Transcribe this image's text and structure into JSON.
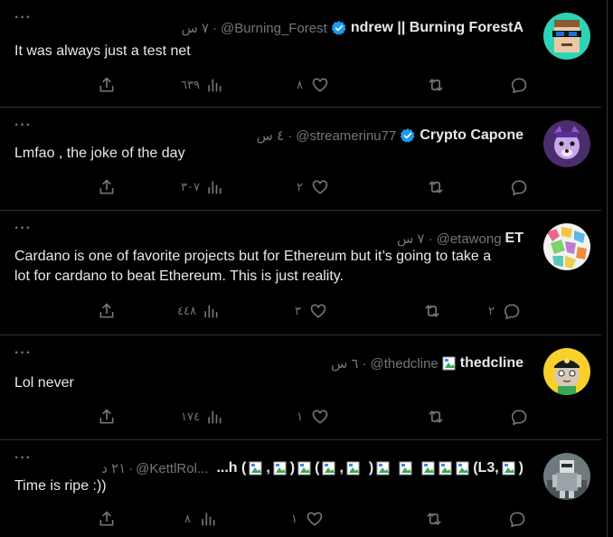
{
  "tweets": [
    {
      "name": "ndrew || Burning ForestA",
      "handle": "@Burning_Forest",
      "time": "٧ س",
      "text": "It was always just a test net",
      "views": "٦٣٩",
      "likes": "٨",
      "retweets": "",
      "replies": "",
      "verified": true
    },
    {
      "name": "Crypto Capone",
      "handle": "@streamerinu77",
      "time": "٤ س",
      "text": "Lmfao , the joke of the day",
      "views": "٣٠٧",
      "likes": "٢",
      "retweets": "",
      "replies": "",
      "verified": true
    },
    {
      "name": "ET",
      "handle": "@etawong",
      "time": "٧ س",
      "text_line1": "Cardano is one of favorite projects but for Ethereum but it’s going to take a",
      "text_line2": "lot for cardano to beat Ethereum. This is just reality.",
      "views": "٤٤٨",
      "likes": "٣",
      "retweets": "",
      "replies": "٢",
      "verified": false
    },
    {
      "name": "thedcline",
      "handle": "@thedcline",
      "time": "٦ س",
      "text": "Lol never",
      "views": "١٧٤",
      "likes": "١",
      "retweets": "",
      "replies": "",
      "verified": false
    },
    {
      "name_prefix": "...h (",
      "name_mid1": ",",
      "name_mid2": ")",
      "name_mid3": "(",
      "name_mid4": ",",
      "name_mid5": ")",
      "name_suffix": "(L3,",
      "name_end": ")",
      "handle": "@KettlRol...",
      "time": "٢١ د",
      "text": "Time is ripe :))",
      "views": "٨",
      "likes": "١",
      "retweets": "",
      "replies": "",
      "verified": false
    }
  ],
  "dot_sep": "·",
  "more_glyph": "···",
  "icons": [
    "share-icon",
    "views-icon",
    "like-icon",
    "retweet-icon",
    "reply-icon",
    "verified-badge-icon",
    "more-icon"
  ],
  "colors": {
    "background": "#000000",
    "text": "#e7e9ea",
    "muted": "#71767b",
    "border": "#2f3336",
    "verified": "#1d9bf0"
  }
}
